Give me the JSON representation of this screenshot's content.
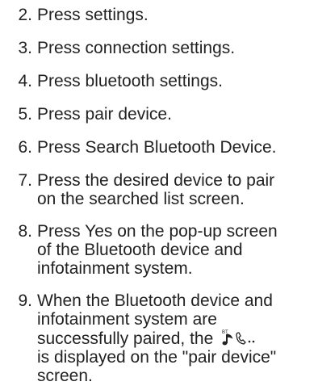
{
  "steps": [
    {
      "num": "2.",
      "text": "Press settings."
    },
    {
      "num": "3.",
      "text": "Press connection settings."
    },
    {
      "num": "4.",
      "text": "Press bluetooth settings."
    },
    {
      "num": "5.",
      "text": "Press pair device."
    },
    {
      "num": "6.",
      "text": "Press Search Bluetooth Device."
    },
    {
      "num": "7.",
      "lines": [
        "Press the desired device to pair",
        "on the searched list screen."
      ]
    },
    {
      "num": "8.",
      "lines": [
        "Press Yes on the pop-up screen",
        "of the Bluetooth device and",
        "infotainment system."
      ]
    },
    {
      "num": "9.",
      "lines": [
        "When the Bluetooth device and",
        "infotainment system are"
      ],
      "line3_before": "successfully paired, the",
      "icon_label": "BT",
      "line4": "is displayed on the \"pair device\"",
      "line5": "screen."
    }
  ],
  "icon": {
    "name": "bluetooth-phone-icon"
  }
}
